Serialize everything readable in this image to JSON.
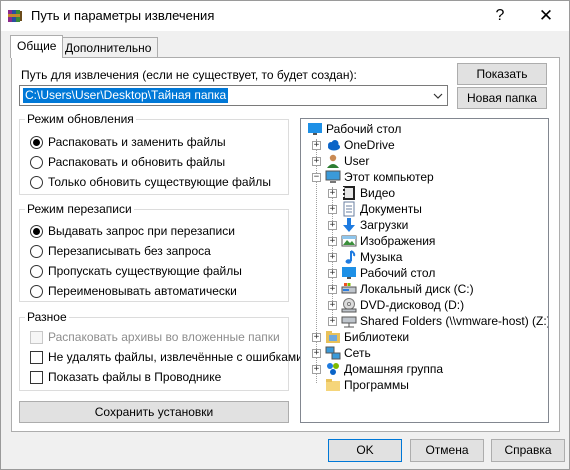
{
  "window": {
    "title": "Путь и параметры извлечения",
    "help_glyph": "?",
    "close_glyph": "✕",
    "icon": "winrar-icon"
  },
  "tabs": [
    {
      "label": "Общие",
      "active": true
    },
    {
      "label": "Дополнительно",
      "active": false
    }
  ],
  "path": {
    "label": "Путь для извлечения (если не существует, то будет создан):",
    "value": "C:\\Users\\User\\Desktop\\Тайная папка",
    "show_button": "Показать",
    "new_folder_button": "Новая папка"
  },
  "update_mode": {
    "title": "Режим обновления",
    "options": [
      {
        "label": "Распаковать и заменить файлы",
        "selected": true
      },
      {
        "label": "Распаковать и обновить файлы",
        "selected": false
      },
      {
        "label": "Только обновить существующие файлы",
        "selected": false
      }
    ]
  },
  "overwrite_mode": {
    "title": "Режим перезаписи",
    "options": [
      {
        "label": "Выдавать запрос при перезаписи",
        "selected": true
      },
      {
        "label": "Перезаписывать без запроса",
        "selected": false
      },
      {
        "label": "Пропускать существующие файлы",
        "selected": false
      },
      {
        "label": "Переименовывать автоматически",
        "selected": false
      }
    ]
  },
  "misc": {
    "title": "Разное",
    "options": [
      {
        "label": "Распаковать архивы во вложенные папки",
        "checked": false,
        "disabled": true
      },
      {
        "label": "Не удалять файлы, извлечённые с ошибками",
        "checked": false,
        "disabled": false
      },
      {
        "label": "Показать файлы в Проводнике",
        "checked": false,
        "disabled": false
      }
    ]
  },
  "save_settings_button": "Сохранить установки",
  "tree": [
    {
      "label": "Рабочий стол",
      "icon": "desktop-icon",
      "level": 0,
      "expander": ""
    },
    {
      "label": "OneDrive",
      "icon": "onedrive-cloud-icon",
      "level": 1,
      "expander": "+"
    },
    {
      "label": "User",
      "icon": "user-icon",
      "level": 1,
      "expander": "+"
    },
    {
      "label": "Этот компьютер",
      "icon": "computer-icon",
      "level": 1,
      "expander": "−"
    },
    {
      "label": "Видео",
      "icon": "video-icon",
      "level": 2,
      "expander": "+"
    },
    {
      "label": "Документы",
      "icon": "documents-icon",
      "level": 2,
      "expander": "+"
    },
    {
      "label": "Загрузки",
      "icon": "downloads-icon",
      "level": 2,
      "expander": "+"
    },
    {
      "label": "Изображения",
      "icon": "pictures-icon",
      "level": 2,
      "expander": "+"
    },
    {
      "label": "Музыка",
      "icon": "music-icon",
      "level": 2,
      "expander": "+"
    },
    {
      "label": "Рабочий стол",
      "icon": "desktop-icon",
      "level": 2,
      "expander": "+"
    },
    {
      "label": "Локальный диск (C:)",
      "icon": "local-disk-icon",
      "level": 2,
      "expander": "+"
    },
    {
      "label": "DVD-дисковод (D:)",
      "icon": "dvd-drive-icon",
      "level": 2,
      "expander": "+"
    },
    {
      "label": "Shared Folders (\\\\vmware-host) (Z:)",
      "icon": "network-drive-icon",
      "level": 2,
      "expander": "+"
    },
    {
      "label": "Библиотеки",
      "icon": "libraries-icon",
      "level": 1,
      "expander": "+"
    },
    {
      "label": "Сеть",
      "icon": "network-icon",
      "level": 1,
      "expander": "+"
    },
    {
      "label": "Домашняя группа",
      "icon": "homegroup-icon",
      "level": 1,
      "expander": "+"
    },
    {
      "label": "Программы",
      "icon": "folder-icon",
      "level": 1,
      "expander": ""
    }
  ],
  "footer": {
    "ok": "OK",
    "cancel": "Отмена",
    "help": "Справка"
  }
}
